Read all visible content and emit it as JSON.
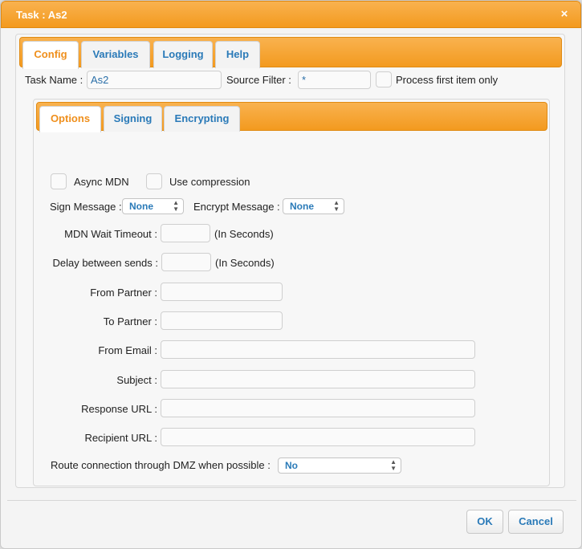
{
  "dialog": {
    "title": "Task : As2",
    "close_glyph": "×"
  },
  "outer_tabs": [
    {
      "label": "Config",
      "active": true
    },
    {
      "label": "Variables",
      "active": false
    },
    {
      "label": "Logging",
      "active": false
    },
    {
      "label": "Help",
      "active": false
    }
  ],
  "config": {
    "task_name_label": "Task Name :",
    "task_name_value": "As2",
    "source_filter_label": "Source Filter :",
    "source_filter_value": "*",
    "process_first_label": "Process first item only",
    "process_first_checked": false
  },
  "inner_tabs": [
    {
      "label": "Options",
      "active": true
    },
    {
      "label": "Signing",
      "active": false
    },
    {
      "label": "Encrypting",
      "active": false
    }
  ],
  "options": {
    "async_mdn_label": "Async MDN",
    "async_mdn_checked": false,
    "use_compression_label": "Use compression",
    "use_compression_checked": false,
    "sign_message_label": "Sign Message :",
    "sign_message_value": "None",
    "encrypt_message_label": "Encrypt Message :",
    "encrypt_message_value": "None",
    "mdn_wait_label": "MDN Wait Timeout :",
    "mdn_wait_value": "",
    "mdn_wait_unit": "(In Seconds)",
    "delay_label": "Delay between sends :",
    "delay_value": "",
    "delay_unit": "(In Seconds)",
    "from_partner_label": "From Partner :",
    "from_partner_value": "",
    "to_partner_label": "To Partner :",
    "to_partner_value": "",
    "from_email_label": "From Email :",
    "from_email_value": "",
    "subject_label": "Subject :",
    "subject_value": "",
    "response_url_label": "Response URL :",
    "response_url_value": "",
    "recipient_url_label": "Recipient URL :",
    "recipient_url_value": "",
    "route_dmz_label": "Route connection through DMZ when possible :",
    "route_dmz_value": "No"
  },
  "footer": {
    "ok_label": "OK",
    "cancel_label": "Cancel"
  },
  "colors": {
    "accent_orange": "#f39a1f",
    "link_blue": "#2a7ab8",
    "active_tab_orange": "#ef8f1c"
  },
  "icons": {
    "close": "close-icon",
    "select_arrows": "up-down-arrows-icon"
  }
}
